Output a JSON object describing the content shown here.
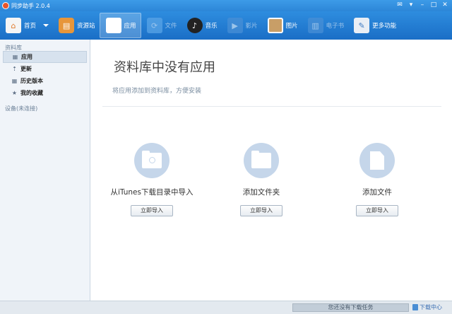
{
  "window": {
    "title": "同步助手 2.0.4"
  },
  "toolbar": {
    "items": [
      {
        "label": "首页",
        "icon": "home-icon",
        "state": "normal"
      },
      {
        "label": "资源站",
        "icon": "store-icon",
        "state": "normal"
      },
      {
        "label": "应用",
        "icon": "apps-icon",
        "state": "active"
      },
      {
        "label": "文件",
        "icon": "files-icon",
        "state": "disabled"
      },
      {
        "label": "音乐",
        "icon": "music-icon",
        "state": "normal"
      },
      {
        "label": "影片",
        "icon": "video-icon",
        "state": "disabled"
      },
      {
        "label": "图片",
        "icon": "photo-icon",
        "state": "normal"
      },
      {
        "label": "电子书",
        "icon": "ebook-icon",
        "state": "disabled"
      },
      {
        "label": "更多功能",
        "icon": "more-tools-icon",
        "state": "normal"
      }
    ]
  },
  "sidebar": {
    "section": "资料库",
    "items": [
      {
        "label": "应用",
        "icon": "grid-icon",
        "active": true
      },
      {
        "label": "更新",
        "icon": "update-icon",
        "active": false
      },
      {
        "label": "历史版本",
        "icon": "history-icon",
        "active": false
      },
      {
        "label": "我的收藏",
        "icon": "star-icon",
        "active": false
      }
    ],
    "device": "设备(未连接)"
  },
  "main": {
    "title": "资料库中没有应用",
    "subtitle": "将应用添加到资料库，方便安装",
    "actions": [
      {
        "label": "从iTunes下载目录中导入",
        "button": "立即导入",
        "icon": "itunes-folder-icon"
      },
      {
        "label": "添加文件夹",
        "button": "立即导入",
        "icon": "folder-icon"
      },
      {
        "label": "添加文件",
        "button": "立即导入",
        "icon": "file-icon"
      }
    ]
  },
  "status": {
    "task": "您还没有下载任务",
    "download_center": "下载中心"
  },
  "colors": {
    "toolbar": "#2e8ddf",
    "sidebar": "#f0f4f9",
    "circle": "#c5d6ea"
  }
}
